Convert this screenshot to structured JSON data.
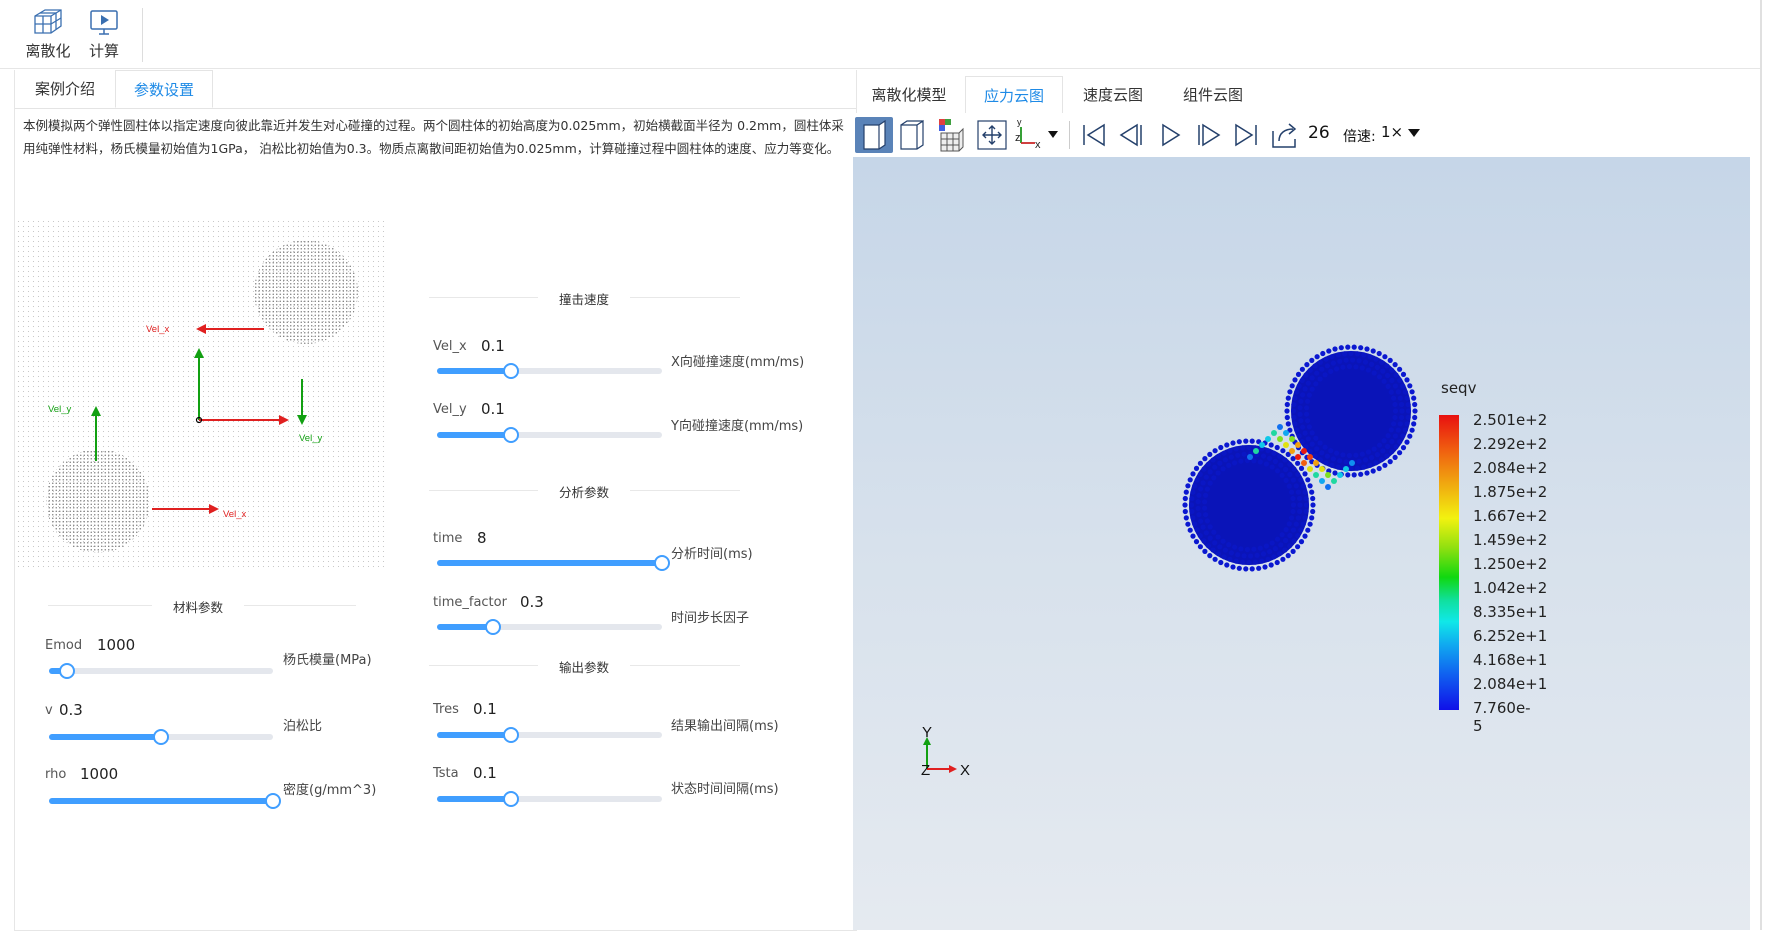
{
  "toolbar": {
    "discretize_label": "离散化",
    "compute_label": "计算"
  },
  "left_tabs": [
    "案例介绍",
    "参数设置"
  ],
  "description": "本例模拟两个弹性圆柱体以指定速度向彼此靠近并发生对心碰撞的过程。两个圆柱体的初始高度为0.025mm，初始横截面半径为 0.2mm，圆柱体采用纯弹性材料，杨氏模量初始值为1GPa， 泊松比初始值为0.3。物质点离散间距初始值为0.025mm，计算碰撞过程中圆柱体的速度、应力等变化。",
  "diagram": {
    "labels": [
      "Vel_x",
      "Vel_y",
      "Vel_y",
      "Vel_x"
    ],
    "colors": {
      "red": "#e02020",
      "green": "#12a012"
    }
  },
  "material": {
    "title": "材料参数",
    "params": [
      {
        "label": "Emod",
        "value": "1000",
        "desc": "杨氏模量(MPa)",
        "fraction": 0.08
      },
      {
        "label": "v",
        "value": "0.3",
        "desc": "泊松比",
        "fraction": 0.5
      },
      {
        "label": "rho",
        "value": "1000",
        "desc": "密度(g/mm^3)",
        "fraction": 1.0
      }
    ]
  },
  "impact": {
    "title": "撞击速度",
    "params": [
      {
        "label": "Vel_x",
        "value": "0.1",
        "desc": "X向碰撞速度(mm/ms)",
        "fraction": 0.33
      },
      {
        "label": "Vel_y",
        "value": "0.1",
        "desc": "Y向碰撞速度(mm/ms)",
        "fraction": 0.33
      }
    ]
  },
  "analysis": {
    "title": "分析参数",
    "params": [
      {
        "label": "time",
        "value": "8",
        "desc": "分析时间(ms)",
        "fraction": 1.0
      },
      {
        "label": "time_factor",
        "value": "0.3",
        "desc": "时间步长因子",
        "fraction": 0.25
      }
    ]
  },
  "output": {
    "title": "输出参数",
    "params": [
      {
        "label": "Tres",
        "value": "0.1",
        "desc": "结果输出间隔(ms)",
        "fraction": 0.33
      },
      {
        "label": "Tsta",
        "value": "0.1",
        "desc": "状态时间间隔(ms)",
        "fraction": 0.33
      }
    ]
  },
  "right_tabs": [
    "离散化模型",
    "应力云图",
    "速度云图",
    "组件云图"
  ],
  "playback": {
    "frame": "26",
    "speed_label": "倍速:",
    "speed_value": "1×"
  },
  "axis_menu": {
    "y": "y",
    "z": "z",
    "x": "x"
  },
  "legend": {
    "title": "seqv",
    "values": [
      "2.501e+2",
      "2.292e+2",
      "2.084e+2",
      "1.875e+2",
      "1.667e+2",
      "1.459e+2",
      "1.250e+2",
      "1.042e+2",
      "8.335e+1",
      "6.252e+1",
      "4.168e+1",
      "2.084e+1",
      "7.760e-5"
    ]
  },
  "triad": {
    "y": "Y",
    "z": "Z",
    "x": "X"
  },
  "colors": {
    "accent": "#1e8ae6",
    "slider": "#409eff"
  }
}
